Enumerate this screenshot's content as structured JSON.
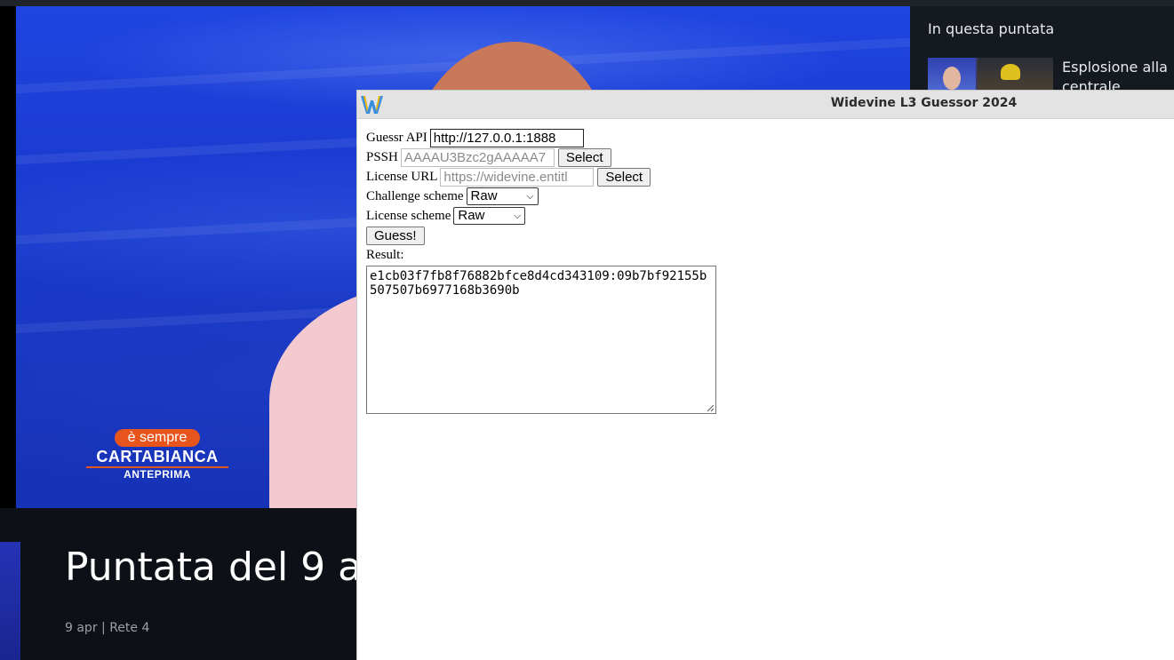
{
  "background_page": {
    "video_overlay": {
      "logo_top": "è sempre",
      "logo_main": "CARTABIANCA",
      "logo_sub": "ANTEPRIMA"
    },
    "side_panel": {
      "title": "In questa puntata",
      "episode_title": "Esplosione alla centrale"
    },
    "page_title": "Puntata del 9 a",
    "meta": "9 apr | Rete 4"
  },
  "popup": {
    "title": "Widevine L3 Guessor 2024",
    "icon": "widevine-w-icon",
    "form": {
      "guessr_api": {
        "label": "Guessr API",
        "value": "http://127.0.0.1:1888"
      },
      "pssh": {
        "label": "PSSH",
        "placeholder": "AAAAU3Bzc2gAAAAA7",
        "button": "Select"
      },
      "license_url": {
        "label": "License URL",
        "placeholder": "https://widevine.entitl",
        "button": "Select"
      },
      "challenge_scheme": {
        "label": "Challenge scheme",
        "selected": "Raw"
      },
      "license_scheme": {
        "label": "License scheme",
        "selected": "Raw"
      },
      "guess_button": "Guess!",
      "result_label": "Result:",
      "result_value": "e1cb03f7fb8f76882bfce8d4cd343109:09b7bf92155b507507b6977168b3690b"
    }
  }
}
